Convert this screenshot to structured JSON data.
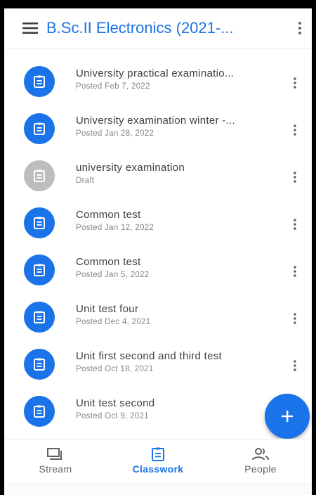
{
  "header": {
    "title": "B.Sc.II Electronics (2021-..."
  },
  "assignments": [
    {
      "title": "University practical examinatio...",
      "subtitle": "Posted Feb 7, 2022",
      "draft": false
    },
    {
      "title": "University examination winter -...",
      "subtitle": "Posted Jan 28, 2022",
      "draft": false
    },
    {
      "title": "university examination",
      "subtitle": "Draft",
      "draft": true
    },
    {
      "title": "Common test",
      "subtitle": "Posted Jan 12, 2022",
      "draft": false
    },
    {
      "title": "Common test",
      "subtitle": "Posted Jan 5, 2022",
      "draft": false
    },
    {
      "title": "Unit test four",
      "subtitle": "Posted Dec 4, 2021",
      "draft": false
    },
    {
      "title": "Unit first second and third test",
      "subtitle": "Posted Oct 18, 2021",
      "draft": false
    },
    {
      "title": "Unit test second",
      "subtitle": "Posted Oct 9, 2021",
      "draft": false
    }
  ],
  "bottom_nav": [
    {
      "label": "Stream",
      "icon": "stream-icon",
      "active": false
    },
    {
      "label": "Classwork",
      "icon": "classwork-icon",
      "active": true
    },
    {
      "label": "People",
      "icon": "people-icon",
      "active": false
    }
  ],
  "colors": {
    "accent": "#1a73e8",
    "draft": "#bdbdbd",
    "text": "#3c4043",
    "subtext": "#80868b"
  }
}
